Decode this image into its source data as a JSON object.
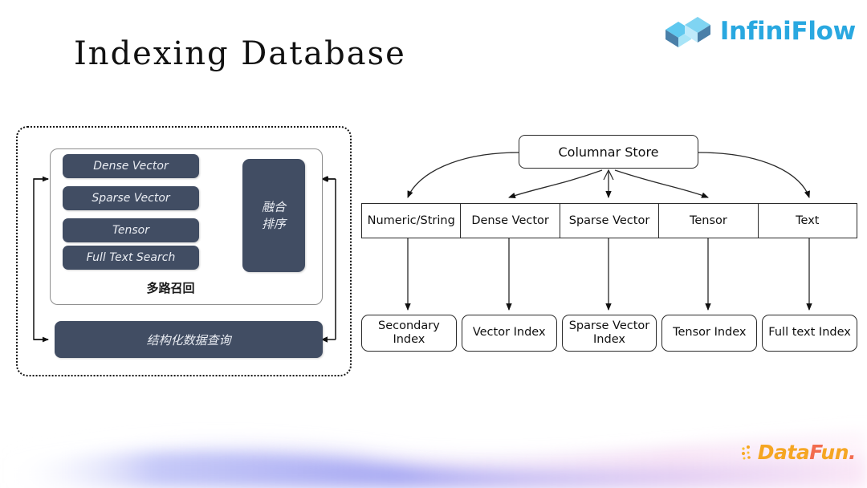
{
  "page": {
    "title": "Indexing Database",
    "background_color": "#ffffff",
    "dark_box_color": "#414d63",
    "accent_blue": "#29a8e0",
    "accent_orange": "#f5a623"
  },
  "brand": {
    "name": "InfiniFlow",
    "logo_icon": "infinity-cube-icon"
  },
  "footer_brand": {
    "d": "D",
    "ata": "ata",
    "f": "F",
    "un": "un",
    "dot": ".",
    "full_name": "DataFun.",
    "logo_icon": "datafun-dots-icon"
  },
  "left_diagram": {
    "name": "query-pipeline",
    "recall_panel_label": "多路召回",
    "retrieval_methods": [
      "Dense Vector",
      "Sparse Vector",
      "Tensor",
      "Full Text Search"
    ],
    "fusion_box": {
      "line1": "融合",
      "line2": "排序"
    },
    "structured_query_label": "结构化数据查询"
  },
  "right_diagram": {
    "name": "storage-index-architecture",
    "root": "Columnar Store",
    "data_types": [
      "Numeric/String",
      "Dense Vector",
      "Sparse Vector",
      "Tensor",
      "Text"
    ],
    "indexes": [
      {
        "line1": "Secondary",
        "line2": "Index"
      },
      {
        "line1": "Vector Index",
        "line2": ""
      },
      {
        "line1": "Sparse Vector",
        "line2": "Index"
      },
      {
        "line1": "Tensor Index",
        "line2": ""
      },
      {
        "line1": "Full text Index",
        "line2": ""
      }
    ]
  }
}
